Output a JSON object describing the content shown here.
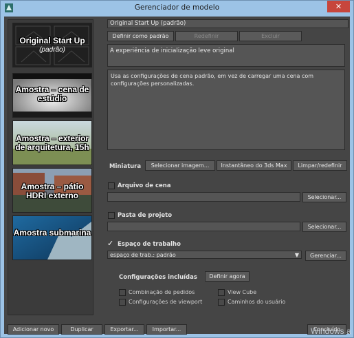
{
  "window": {
    "title": "Gerenciador de modelo",
    "close_label": "✕"
  },
  "templates": [
    {
      "name": "Original Start Up",
      "sub": "(padrão)"
    },
    {
      "name": "Amostra – cena de estúdio"
    },
    {
      "name": "Amostra – exterior de arquitetura, 15h"
    },
    {
      "name": "Amostra – pátio HDRI externo"
    },
    {
      "name": "Amostra submarina"
    }
  ],
  "details": {
    "name_value": "Original Start Up (padrão)",
    "set_default_label": "Definir como padrão",
    "rename_label": "Redefinir",
    "delete_label": "Excluir",
    "short_desc": "A experiência de inicialização leve original",
    "long_desc": "Usa as configurações de cena padrão, em vez de carregar uma cena com configurações personalizadas.",
    "thumbnail_label": "Miniatura",
    "select_image_label": "Selecionar imagem...",
    "snapshot_label": "Instantâneo do 3ds Max",
    "clear_reset_label": "Limpar/redefinir",
    "scene_file_label": "Arquivo de cena",
    "scene_file_value": "",
    "scene_select_label": "Selecionar...",
    "project_folder_label": "Pasta de projeto",
    "project_folder_value": "",
    "project_select_label": "Selecionar...",
    "workspace_label": "Espaço de trabalho",
    "workspace_value": "espaço de trab.: padrão",
    "workspace_manage_label": "Gerenciar...",
    "included_settings_label": "Configurações incluídas",
    "define_now_label": "Definir agora",
    "settings": [
      "Combinação de pedidos",
      "View Cube",
      "Configurações de viewport",
      "Caminhos do usuário"
    ]
  },
  "footer": {
    "add_new": "Adicionar novo",
    "duplicate": "Duplicar",
    "export": "Exportar...",
    "import": "Importar...",
    "done": "Concluído"
  },
  "watermark": "Windows a"
}
